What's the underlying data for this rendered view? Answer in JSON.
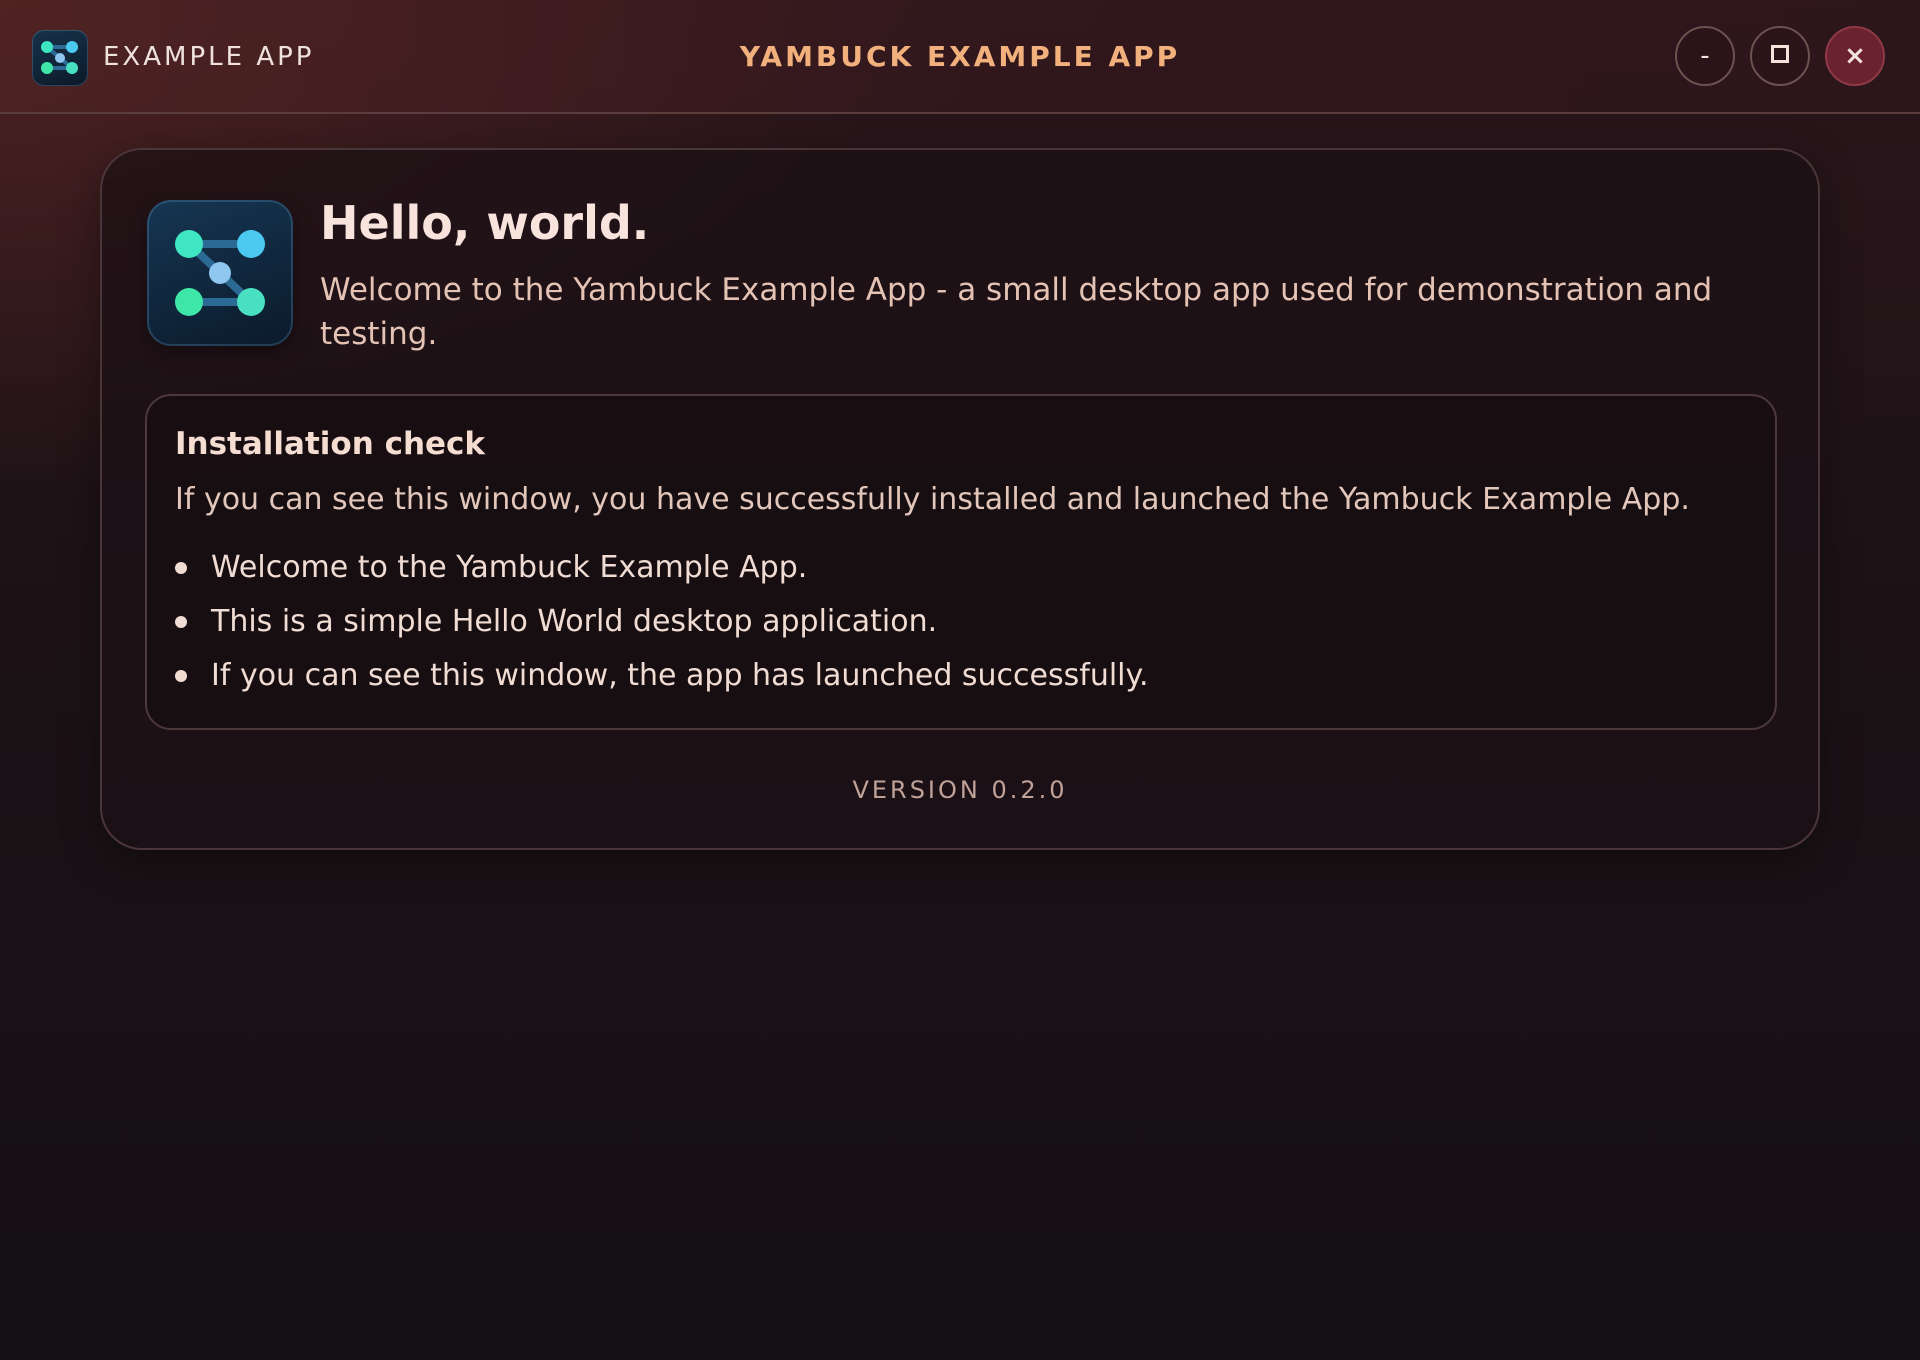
{
  "titlebar": {
    "app_name": "EXAMPLE APP",
    "window_title": "YAMBUCK EXAMPLE APP",
    "minimize_label": "-",
    "close_label": "×",
    "title_color": "#f2b07d",
    "close_color": "#6b2230"
  },
  "hero": {
    "logo_icon": "app-logo-icon",
    "heading": "Hello, world.",
    "welcome": "Welcome to the Yambuck Example App - a small desktop app used for demonstration and testing."
  },
  "installation": {
    "title": "Installation check",
    "description": "If you can see this window, you have successfully installed and launched the Yambuck Example App.",
    "items": [
      "Welcome to the Yambuck Example App.",
      "This is a simple Hello World desktop application.",
      "If you can see this window, the app has launched successfully."
    ]
  },
  "footer": {
    "version": "VERSION 0.2.0"
  },
  "colors": {
    "logo_dot_green": "#3ee6a8",
    "logo_dot_blue": "#4cc9f0",
    "logo_dot_center": "#8fc7f0"
  }
}
